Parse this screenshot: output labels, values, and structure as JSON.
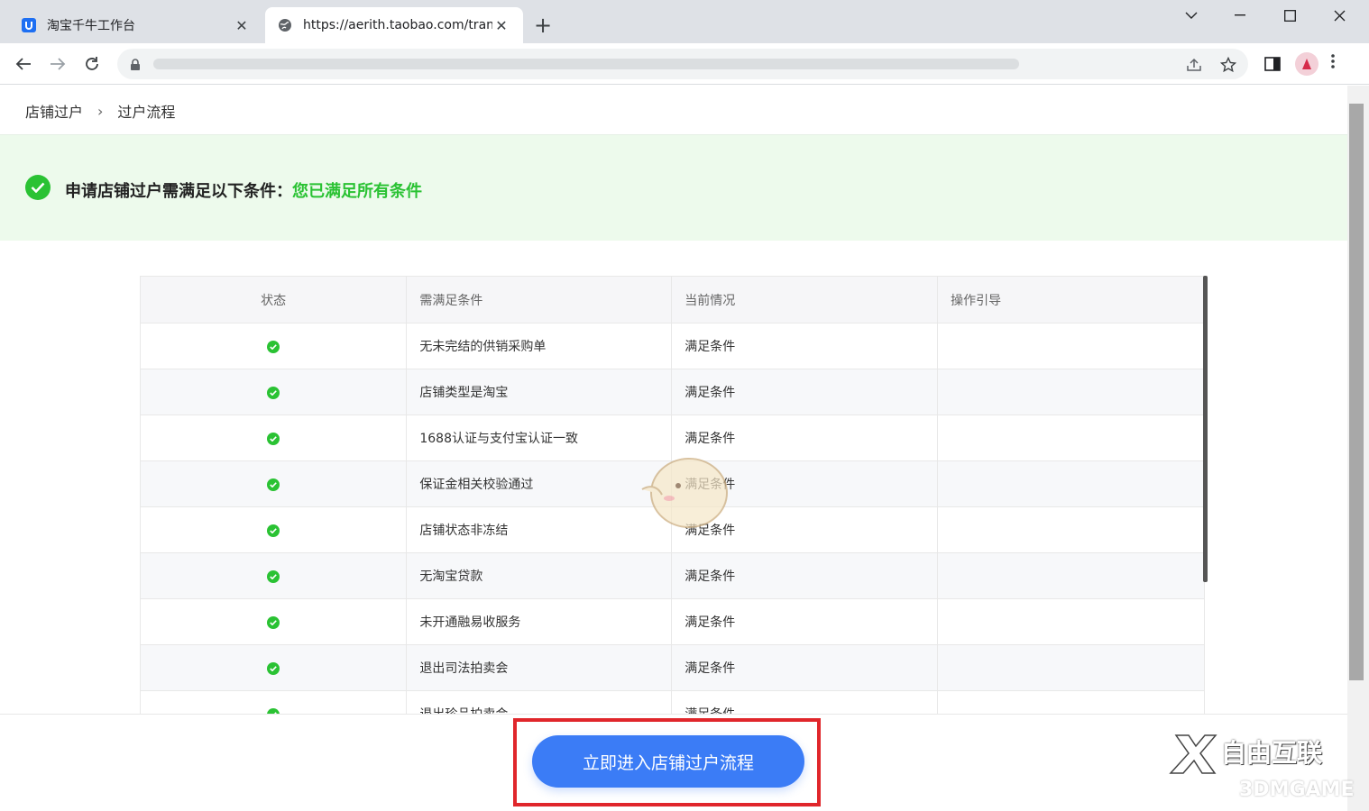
{
  "browser": {
    "tabs": [
      {
        "title": "淘宝千牛工作台",
        "active": false
      },
      {
        "title": "https://aerith.taobao.com/tran",
        "active": true
      }
    ],
    "new_tab": "+",
    "close_glyph": "✕"
  },
  "breadcrumb": {
    "items": [
      "店铺过户",
      "过户流程"
    ],
    "separator": "›"
  },
  "banner": {
    "text": "申请店铺过户需满足以下条件：",
    "status": "您已满足所有条件",
    "accent_color": "#2ac233"
  },
  "table": {
    "headers": [
      "状态",
      "需满足条件",
      "当前情况",
      "操作引导"
    ],
    "rows": [
      {
        "condition": "无未完结的供销采购单",
        "current": "满足条件",
        "guide": ""
      },
      {
        "condition": "店铺类型是淘宝",
        "current": "满足条件",
        "guide": ""
      },
      {
        "condition": "1688认证与支付宝认证一致",
        "current": "满足条件",
        "guide": ""
      },
      {
        "condition": "保证金相关校验通过",
        "current": "满足条件",
        "guide": ""
      },
      {
        "condition": "店铺状态非冻结",
        "current": "满足条件",
        "guide": ""
      },
      {
        "condition": "无淘宝贷款",
        "current": "满足条件",
        "guide": ""
      },
      {
        "condition": "未开通融易收服务",
        "current": "满足条件",
        "guide": ""
      },
      {
        "condition": "退出司法拍卖会",
        "current": "满足条件",
        "guide": ""
      },
      {
        "condition": "退出珍品拍卖会",
        "current": "满足条件",
        "guide": ""
      }
    ]
  },
  "footer": {
    "cta_label": "立即进入店铺过户流程",
    "cta_color": "#3b7cf6",
    "highlight_color": "#e0262b"
  },
  "watermark": {
    "title": "自由互联",
    "sub": "3DMGAME"
  }
}
